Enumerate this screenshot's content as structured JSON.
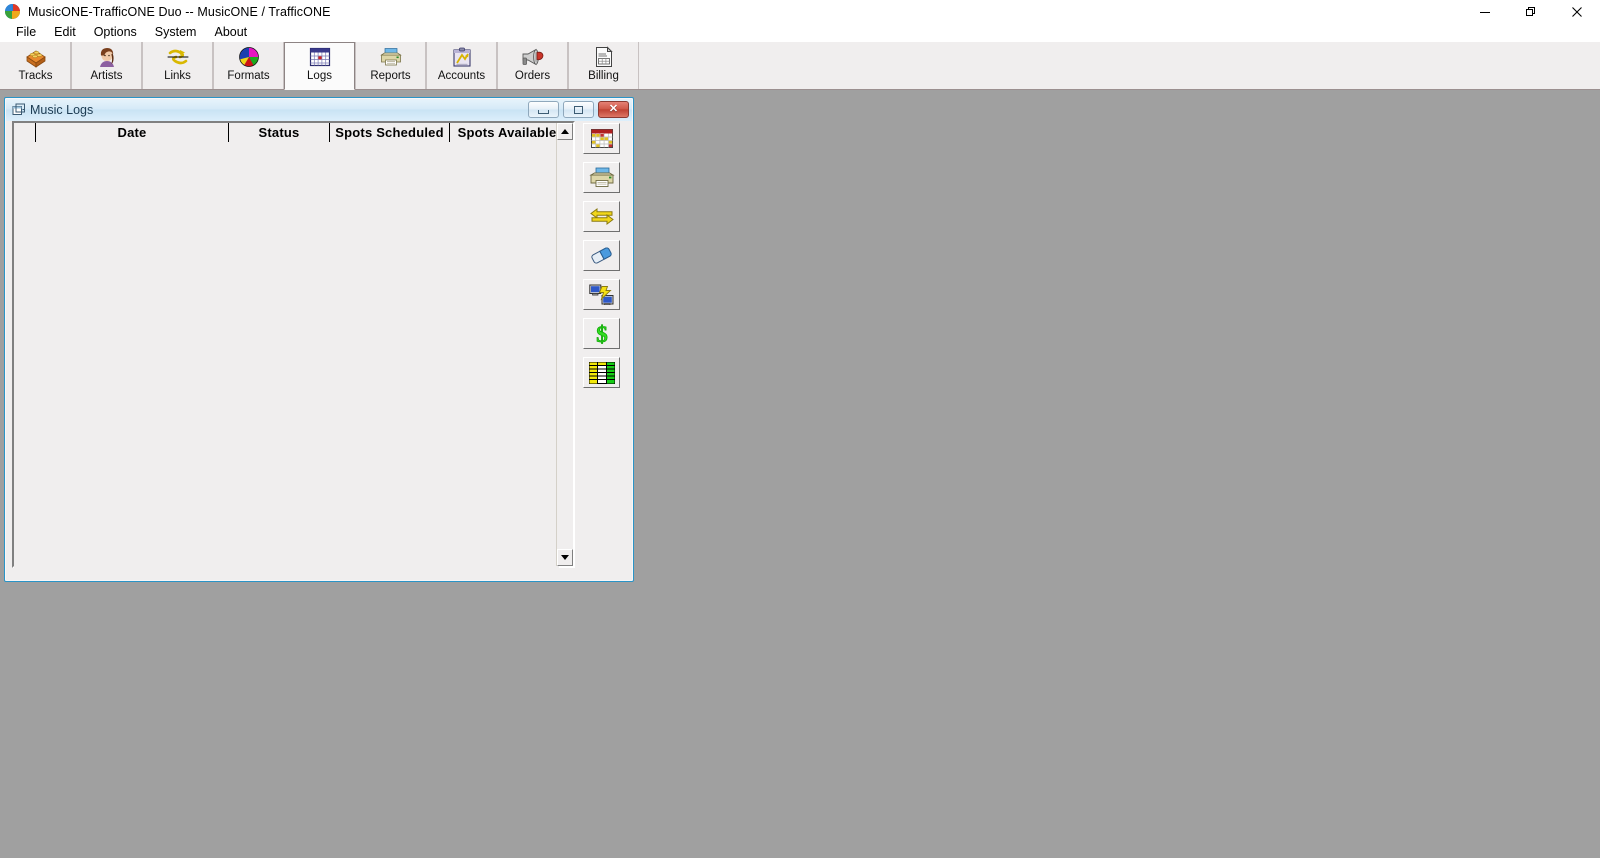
{
  "window": {
    "title": "MusicONE-TrafficONE Duo -- MusicONE / TrafficONE",
    "logo_icon": "color-sphere-logo-icon",
    "controls": [
      {
        "name": "minimize-button",
        "icon": "minimize-icon",
        "label": "Minimize"
      },
      {
        "name": "restore-button",
        "icon": "restore-icon",
        "label": "Restore"
      },
      {
        "name": "close-button",
        "icon": "close-icon",
        "label": "Close"
      }
    ]
  },
  "menubar": {
    "items": [
      {
        "label": "File"
      },
      {
        "label": "Edit"
      },
      {
        "label": "Options"
      },
      {
        "label": "System"
      },
      {
        "label": "About"
      }
    ]
  },
  "ribbon": {
    "buttons": [
      {
        "label": "Tracks",
        "icon": "tracks-crate-icon",
        "active": false
      },
      {
        "label": "Artists",
        "icon": "artist-person-icon",
        "active": false
      },
      {
        "label": "Links",
        "icon": "links-chain-icon",
        "active": false
      },
      {
        "label": "Formats",
        "icon": "formats-pie-icon",
        "active": false
      },
      {
        "label": "Logs",
        "icon": "logs-calendar-icon",
        "active": true
      },
      {
        "label": "Reports",
        "icon": "reports-printer-icon",
        "active": false
      },
      {
        "label": "Accounts",
        "icon": "accounts-clipboard-icon",
        "active": false
      },
      {
        "label": "Orders",
        "icon": "orders-megaphone-icon",
        "active": false
      },
      {
        "label": "Billing",
        "icon": "billing-invoice-icon",
        "active": false
      }
    ]
  },
  "child_window": {
    "title": "Music Logs",
    "icon": "mdi-window-icon",
    "controls": [
      {
        "name": "child-minimize-button",
        "icon": "minimize-icon"
      },
      {
        "name": "child-maximize-button",
        "icon": "maximize-icon"
      },
      {
        "name": "child-close-button",
        "icon": "close-icon"
      }
    ],
    "grid": {
      "columns": [
        {
          "key": "rownum",
          "label": ""
        },
        {
          "key": "date",
          "label": "Date"
        },
        {
          "key": "status",
          "label": "Status"
        },
        {
          "key": "spots_scheduled",
          "label": "Spots Scheduled"
        },
        {
          "key": "spots_available",
          "label": "Spots Available"
        }
      ],
      "rows": []
    },
    "scrollbar": {
      "up_icon": "scroll-up-arrow-icon",
      "down_icon": "scroll-down-arrow-icon"
    },
    "side_tools": [
      {
        "name": "generate-log-button",
        "icon": "calendar-icon"
      },
      {
        "name": "print-log-button",
        "icon": "printer-icon"
      },
      {
        "name": "reconcile-log-button",
        "icon": "swap-arrows-icon"
      },
      {
        "name": "erase-log-button",
        "icon": "eraser-icon"
      },
      {
        "name": "export-log-button",
        "icon": "computer-transfer-icon"
      },
      {
        "name": "billing-log-button",
        "icon": "dollar-sign-icon"
      },
      {
        "name": "spreadsheet-log-button",
        "icon": "spreadsheet-grid-icon"
      }
    ]
  },
  "colors": {
    "mdi_background": "#a0a0a0",
    "ribbon_background": "#f0eeee",
    "child_border": "#2a94c7",
    "close_button": "#c04434",
    "dollar_green": "#33dd22"
  }
}
